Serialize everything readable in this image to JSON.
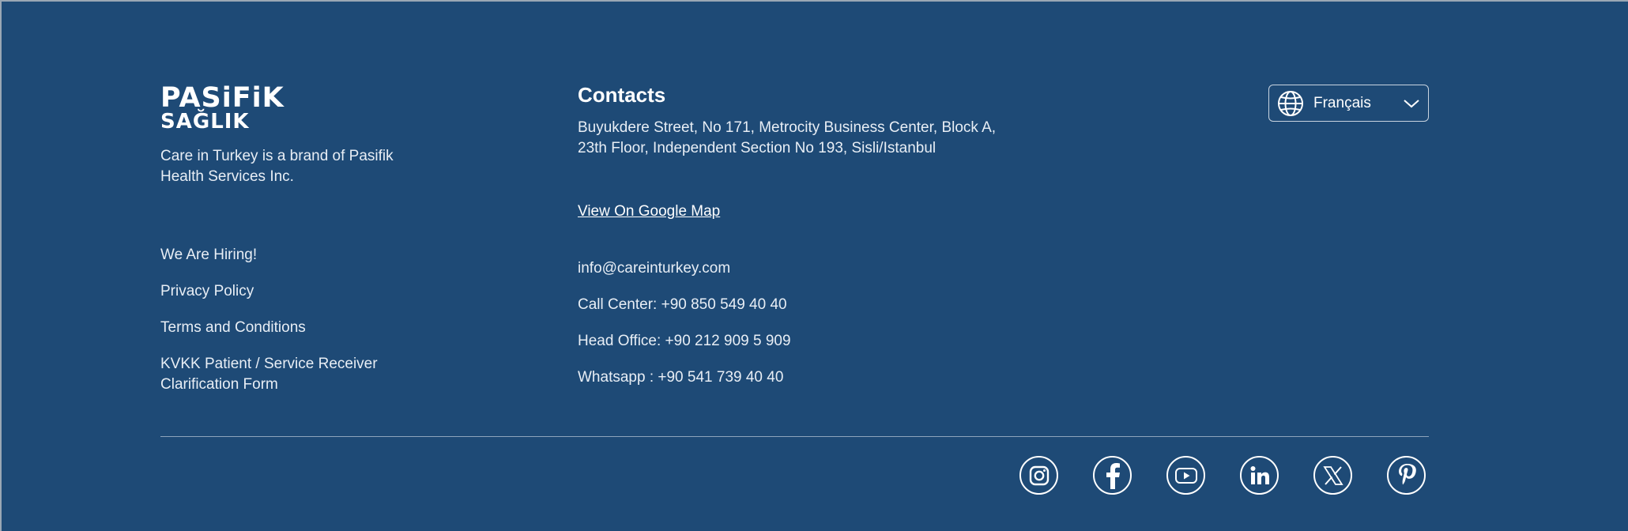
{
  "brand": {
    "logo_line1": "PASiFiK",
    "logo_line2": "SAĞLIK",
    "tagline": "Care in Turkey is a brand of Pasifik Health Services Inc."
  },
  "links": [
    {
      "label": "We Are Hiring!"
    },
    {
      "label": "Privacy Policy"
    },
    {
      "label": "Terms and Conditions"
    },
    {
      "label": "KVKK Patient / Service Receiver Clarification Form"
    }
  ],
  "contacts": {
    "title": "Contacts",
    "address": "Buyukdere Street, No 171, Metrocity Business Center, Block A, 23th Floor, Independent Section No 193, Sisli/Istanbul",
    "map_link": "View On Google Map",
    "email": "info@careinturkey.com",
    "call_center": "Call Center: +90 850 549 40 40",
    "head_office": "Head Office: +90 212 909 5 909",
    "whatsapp": "Whatsapp : +90 541 739 40 40"
  },
  "language": {
    "selected": "Français",
    "icon": "globe-icon"
  },
  "social": [
    {
      "name": "instagram",
      "icon": "instagram-icon"
    },
    {
      "name": "facebook",
      "icon": "facebook-icon"
    },
    {
      "name": "youtube",
      "icon": "youtube-icon"
    },
    {
      "name": "linkedin",
      "icon": "linkedin-icon"
    },
    {
      "name": "x",
      "icon": "x-icon"
    },
    {
      "name": "pinterest",
      "icon": "pinterest-icon"
    }
  ],
  "colors": {
    "background": "#1e4a76",
    "text": "#ffffff"
  }
}
